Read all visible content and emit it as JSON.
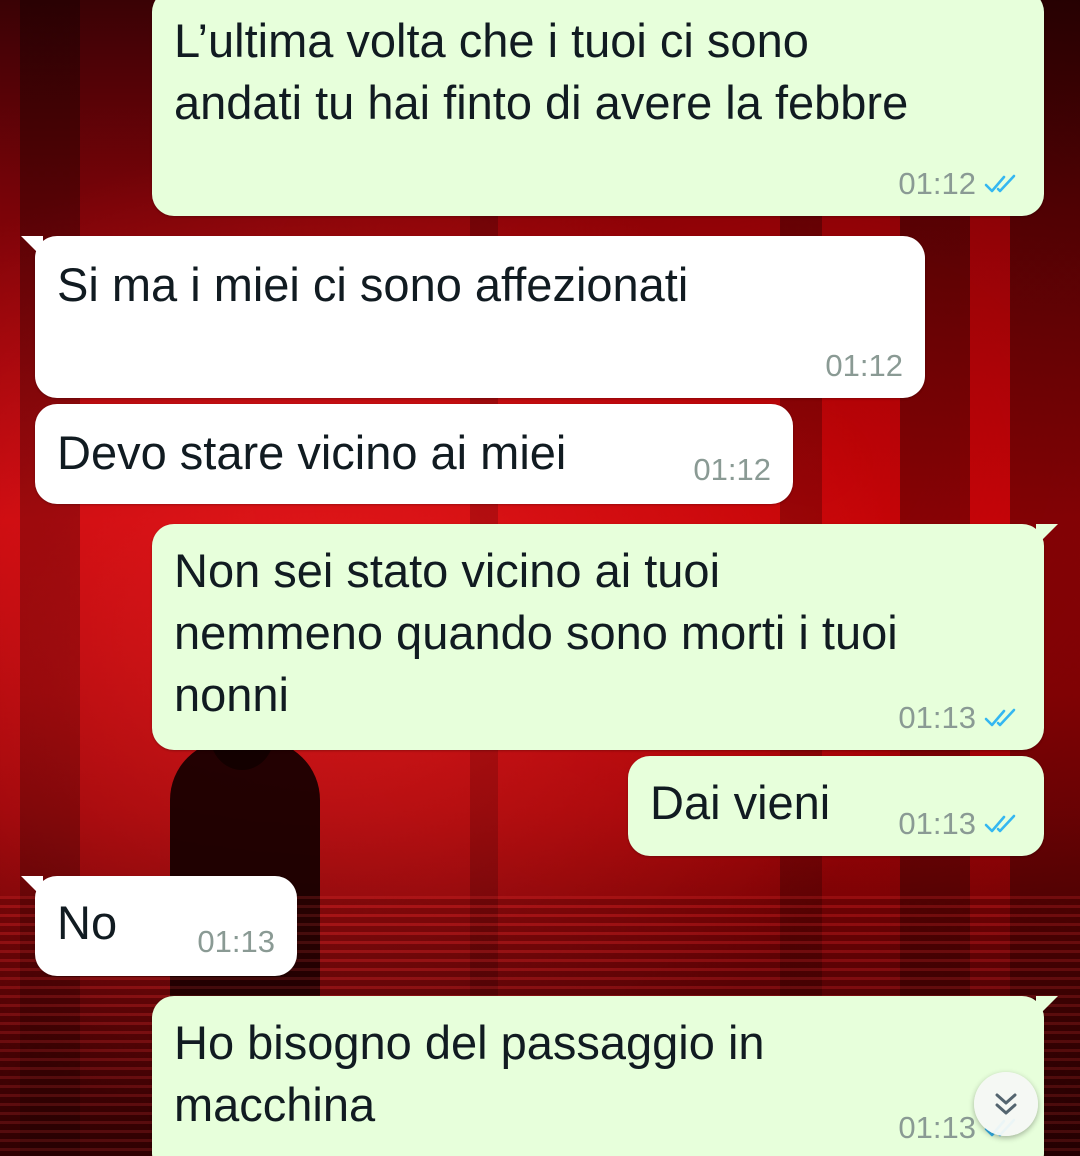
{
  "messages": [
    {
      "direction": "out",
      "text": "L’ultima volta che i tuoi ci sono\nandati tu hai finto di avere la febbre",
      "time": "01:12",
      "status": "read"
    },
    {
      "direction": "in",
      "text": "Si ma i miei ci sono affezionati",
      "time": "01:12"
    },
    {
      "direction": "in",
      "text": "Devo stare vicino ai miei",
      "time": "01:12"
    },
    {
      "direction": "out",
      "text": "Non sei stato vicino ai tuoi\nnemmeno quando sono morti i tuoi\nnonni",
      "time": "01:13",
      "status": "read"
    },
    {
      "direction": "out",
      "text": "Dai vieni",
      "time": "01:13",
      "status": "read"
    },
    {
      "direction": "in",
      "text": "No",
      "time": "01:13"
    },
    {
      "direction": "out",
      "text": "Ho bisogno del passaggio in\nmacchina",
      "time": "01:13",
      "status": "read"
    }
  ],
  "scroll_button": {
    "icon": "double-chevron-down-icon"
  },
  "colors": {
    "outgoing_bubble": "#e7ffdb",
    "incoming_bubble": "#ffffff",
    "read_ticks": "#34b7f1",
    "timestamp": "#8a9a94",
    "wallpaper": "#c2060c"
  }
}
